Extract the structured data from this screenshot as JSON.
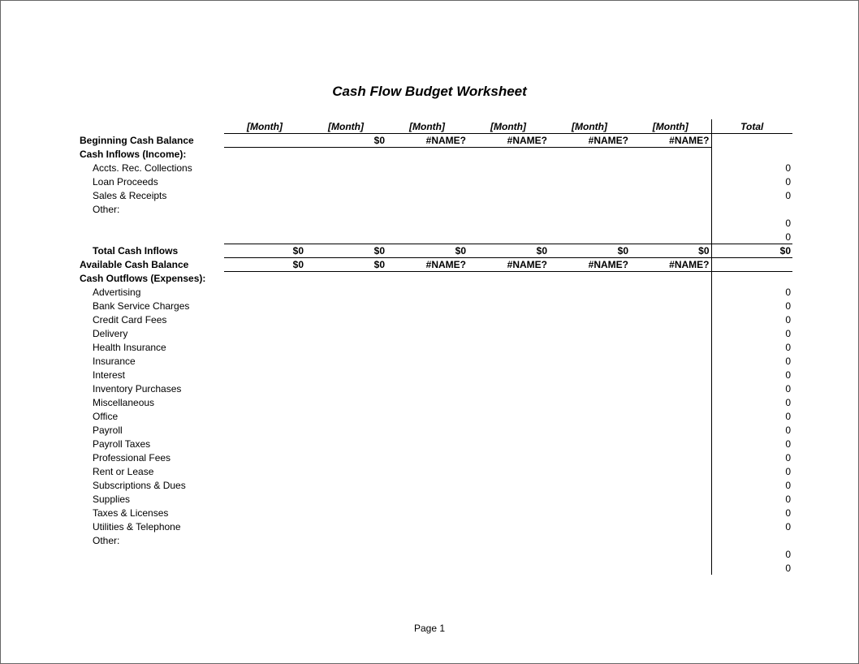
{
  "title": "Cash Flow Budget Worksheet",
  "footer": "Page 1",
  "headers": [
    "[Month]",
    "[Month]",
    "[Month]",
    "[Month]",
    "[Month]",
    "[Month]",
    "Total"
  ],
  "begBalLabel": "Beginning Cash Balance",
  "begBal": [
    "",
    "$0",
    "#NAME?",
    "#NAME?",
    "#NAME?",
    "#NAME?",
    ""
  ],
  "inflowsHeader": "Cash Inflows (Income):",
  "inflowItems": [
    {
      "label": "Accts. Rec. Collections",
      "total": "0"
    },
    {
      "label": "Loan Proceeds",
      "total": "0"
    },
    {
      "label": "Sales & Receipts",
      "total": "0"
    },
    {
      "label": "Other:",
      "total": ""
    },
    {
      "label": "",
      "total": "0"
    },
    {
      "label": "",
      "total": "0"
    }
  ],
  "totalInflowsLabel": "Total Cash Inflows",
  "totalInflows": [
    "$0",
    "$0",
    "$0",
    "$0",
    "$0",
    "$0",
    "$0"
  ],
  "availBalLabel": "Available Cash Balance",
  "availBal": [
    "$0",
    "$0",
    "#NAME?",
    "#NAME?",
    "#NAME?",
    "#NAME?",
    ""
  ],
  "outflowsHeader": "Cash Outflows (Expenses):",
  "outflowItems": [
    {
      "label": "Advertising",
      "total": "0"
    },
    {
      "label": "Bank Service Charges",
      "total": "0"
    },
    {
      "label": "Credit Card Fees",
      "total": "0"
    },
    {
      "label": "Delivery",
      "total": "0"
    },
    {
      "label": "Health Insurance",
      "total": "0"
    },
    {
      "label": "Insurance",
      "total": "0"
    },
    {
      "label": "Interest",
      "total": "0"
    },
    {
      "label": "Inventory Purchases",
      "total": "0"
    },
    {
      "label": "Miscellaneous",
      "total": "0"
    },
    {
      "label": "Office",
      "total": "0"
    },
    {
      "label": "Payroll",
      "total": "0"
    },
    {
      "label": "Payroll Taxes",
      "total": "0"
    },
    {
      "label": "Professional Fees",
      "total": "0"
    },
    {
      "label": "Rent or Lease",
      "total": "0"
    },
    {
      "label": "Subscriptions & Dues",
      "total": "0"
    },
    {
      "label": "Supplies",
      "total": "0"
    },
    {
      "label": "Taxes & Licenses",
      "total": "0"
    },
    {
      "label": "Utilities & Telephone",
      "total": "0"
    },
    {
      "label": "Other:",
      "total": ""
    },
    {
      "label": "",
      "total": "0"
    },
    {
      "label": "",
      "total": "0"
    }
  ]
}
